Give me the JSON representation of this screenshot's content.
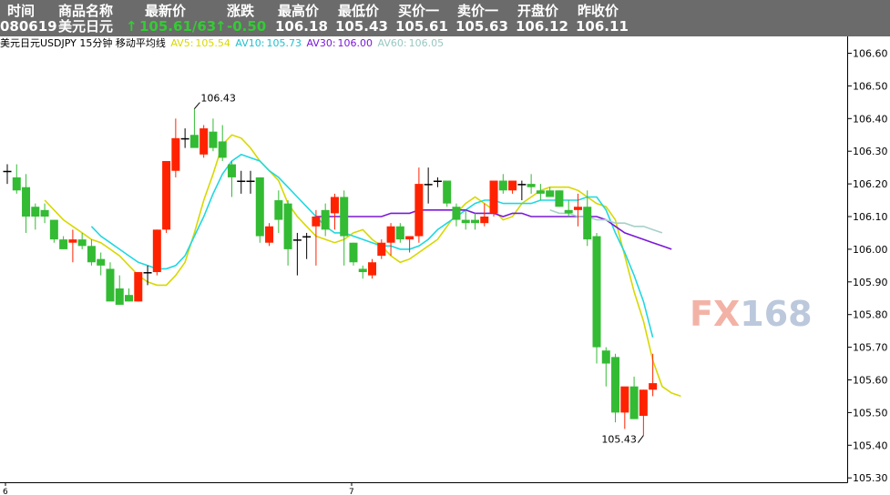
{
  "header": {
    "columns": [
      "时间",
      "商品名称",
      "最新价",
      "涨跌",
      "最高价",
      "最低价",
      "买价一",
      "卖价一",
      "开盘价",
      "昨收价"
    ],
    "values": {
      "time": "080619",
      "name": "美元日元",
      "last": "105.61/63",
      "change": "-0.50",
      "high": "106.18",
      "low": "105.43",
      "bid": "105.61",
      "ask": "105.63",
      "open": "106.12",
      "prev_close": "106.11"
    },
    "arrow": "↑"
  },
  "indicator": {
    "title": "美元日元USDJPY 15分钟 移动平均线",
    "ma": [
      {
        "label": "AV5:",
        "value": "105.54",
        "color": "#d8d800"
      },
      {
        "label": "AV10:",
        "value": "105.73",
        "color": "#20d8e0"
      },
      {
        "label": "AV30:",
        "value": "106.00",
        "color": "#7a18d8"
      },
      {
        "label": "AV60:",
        "value": "106.05",
        "color": "#a8d0c8"
      }
    ]
  },
  "watermark": {
    "left": "FX",
    "right": "168",
    "left_color": "#f2b3a6",
    "right_color": "#bcc8dc"
  },
  "colors": {
    "up": "#ff2200",
    "down": "#33bb33",
    "doji": "#000000",
    "axis": "#000000"
  },
  "chart_data": {
    "type": "candlestick",
    "ylim": [
      105.3,
      106.68
    ],
    "y_ticks": [
      "106.60",
      "106.50",
      "106.40",
      "106.30",
      "106.20",
      "106.10",
      "106.00",
      "105.90",
      "105.80",
      "105.70",
      "105.60",
      "105.50",
      "105.40",
      "105.30"
    ],
    "x_ticks": [
      {
        "label": "6",
        "index": 0
      },
      {
        "label": "7",
        "index": 37
      }
    ],
    "annotations": [
      {
        "text": "106.43",
        "index": 20,
        "value": 106.43
      },
      {
        "text": "105.43",
        "index": 68,
        "value": 105.43
      }
    ],
    "candles": [
      {
        "o": 106.24,
        "h": 106.26,
        "l": 106.2,
        "c": 106.24
      },
      {
        "o": 106.22,
        "h": 106.26,
        "l": 106.17,
        "c": 106.18
      },
      {
        "o": 106.19,
        "h": 106.23,
        "l": 106.05,
        "c": 106.1
      },
      {
        "o": 106.13,
        "h": 106.14,
        "l": 106.06,
        "c": 106.1
      },
      {
        "o": 106.12,
        "h": 106.14,
        "l": 106.08,
        "c": 106.1
      },
      {
        "o": 106.09,
        "h": 106.09,
        "l": 106.02,
        "c": 106.03
      },
      {
        "o": 106.03,
        "h": 106.04,
        "l": 106.0,
        "c": 106.0
      },
      {
        "o": 106.02,
        "h": 106.06,
        "l": 105.96,
        "c": 106.03
      },
      {
        "o": 106.03,
        "h": 106.05,
        "l": 106.0,
        "c": 106.01
      },
      {
        "o": 106.01,
        "h": 106.03,
        "l": 105.95,
        "c": 105.96
      },
      {
        "o": 105.97,
        "h": 105.99,
        "l": 105.92,
        "c": 105.95
      },
      {
        "o": 105.94,
        "h": 105.96,
        "l": 105.85,
        "c": 105.84
      },
      {
        "o": 105.88,
        "h": 105.92,
        "l": 105.83,
        "c": 105.83
      },
      {
        "o": 105.86,
        "h": 105.88,
        "l": 105.84,
        "c": 105.84
      },
      {
        "o": 105.84,
        "h": 105.93,
        "l": 105.84,
        "c": 105.93
      },
      {
        "o": 105.93,
        "h": 105.95,
        "l": 105.89,
        "c": 105.93
      },
      {
        "o": 105.93,
        "h": 106.06,
        "l": 105.92,
        "c": 106.06
      },
      {
        "o": 106.06,
        "h": 106.27,
        "l": 106.05,
        "c": 106.27
      },
      {
        "o": 106.24,
        "h": 106.4,
        "l": 106.22,
        "c": 106.34
      },
      {
        "o": 106.34,
        "h": 106.37,
        "l": 106.31,
        "c": 106.34
      },
      {
        "o": 106.35,
        "h": 106.43,
        "l": 106.33,
        "c": 106.31
      },
      {
        "o": 106.29,
        "h": 106.38,
        "l": 106.28,
        "c": 106.37
      },
      {
        "o": 106.36,
        "h": 106.4,
        "l": 106.3,
        "c": 106.31
      },
      {
        "o": 106.33,
        "h": 106.38,
        "l": 106.27,
        "c": 106.28
      },
      {
        "o": 106.26,
        "h": 106.27,
        "l": 106.16,
        "c": 106.22
      },
      {
        "o": 106.21,
        "h": 106.24,
        "l": 106.17,
        "c": 106.21
      },
      {
        "o": 106.21,
        "h": 106.24,
        "l": 106.17,
        "c": 106.21
      },
      {
        "o": 106.22,
        "h": 106.22,
        "l": 106.02,
        "c": 106.04
      },
      {
        "o": 106.02,
        "h": 106.08,
        "l": 106.01,
        "c": 106.07
      },
      {
        "o": 106.15,
        "h": 106.18,
        "l": 106.05,
        "c": 106.09
      },
      {
        "o": 106.14,
        "h": 106.15,
        "l": 105.95,
        "c": 106.0
      },
      {
        "o": 106.03,
        "h": 106.05,
        "l": 105.92,
        "c": 106.03
      },
      {
        "o": 106.04,
        "h": 106.05,
        "l": 105.97,
        "c": 106.04
      },
      {
        "o": 106.07,
        "h": 106.12,
        "l": 105.95,
        "c": 106.1
      },
      {
        "o": 106.12,
        "h": 106.14,
        "l": 106.04,
        "c": 106.06
      },
      {
        "o": 106.11,
        "h": 106.17,
        "l": 106.06,
        "c": 106.16
      },
      {
        "o": 106.16,
        "h": 106.18,
        "l": 105.95,
        "c": 106.04
      },
      {
        "o": 106.02,
        "h": 106.02,
        "l": 105.95,
        "c": 105.96
      },
      {
        "o": 105.94,
        "h": 105.95,
        "l": 105.91,
        "c": 105.93
      },
      {
        "o": 105.92,
        "h": 105.97,
        "l": 105.91,
        "c": 105.96
      },
      {
        "o": 105.98,
        "h": 106.03,
        "l": 105.97,
        "c": 106.02
      },
      {
        "o": 106.02,
        "h": 106.08,
        "l": 105.98,
        "c": 106.07
      },
      {
        "o": 106.07,
        "h": 106.08,
        "l": 106.02,
        "c": 106.03
      },
      {
        "o": 106.03,
        "h": 106.04,
        "l": 105.99,
        "c": 106.04
      },
      {
        "o": 106.04,
        "h": 106.25,
        "l": 106.02,
        "c": 106.2
      },
      {
        "o": 106.2,
        "h": 106.25,
        "l": 106.14,
        "c": 106.2
      },
      {
        "o": 106.21,
        "h": 106.22,
        "l": 106.19,
        "c": 106.21
      },
      {
        "o": 106.21,
        "h": 106.21,
        "l": 106.13,
        "c": 106.14
      },
      {
        "o": 106.13,
        "h": 106.14,
        "l": 106.07,
        "c": 106.09
      },
      {
        "o": 106.09,
        "h": 106.12,
        "l": 106.06,
        "c": 106.08
      },
      {
        "o": 106.09,
        "h": 106.11,
        "l": 106.06,
        "c": 106.08
      },
      {
        "o": 106.08,
        "h": 106.14,
        "l": 106.07,
        "c": 106.1
      },
      {
        "o": 106.11,
        "h": 106.21,
        "l": 106.1,
        "c": 106.21
      },
      {
        "o": 106.21,
        "h": 106.23,
        "l": 106.17,
        "c": 106.18
      },
      {
        "o": 106.18,
        "h": 106.21,
        "l": 106.17,
        "c": 106.21
      },
      {
        "o": 106.2,
        "h": 106.21,
        "l": 106.15,
        "c": 106.2
      },
      {
        "o": 106.2,
        "h": 106.23,
        "l": 106.17,
        "c": 106.19
      },
      {
        "o": 106.18,
        "h": 106.2,
        "l": 106.15,
        "c": 106.17
      },
      {
        "o": 106.18,
        "h": 106.19,
        "l": 106.16,
        "c": 106.16
      },
      {
        "o": 106.18,
        "h": 106.18,
        "l": 106.13,
        "c": 106.13
      },
      {
        "o": 106.12,
        "h": 106.15,
        "l": 106.1,
        "c": 106.11
      },
      {
        "o": 106.12,
        "h": 106.17,
        "l": 106.07,
        "c": 106.13
      },
      {
        "o": 106.13,
        "h": 106.18,
        "l": 106.01,
        "c": 106.03
      },
      {
        "o": 106.04,
        "h": 106.05,
        "l": 105.65,
        "c": 105.7
      },
      {
        "o": 105.69,
        "h": 105.7,
        "l": 105.58,
        "c": 105.65
      },
      {
        "o": 105.67,
        "h": 105.68,
        "l": 105.47,
        "c": 105.5
      },
      {
        "o": 105.5,
        "h": 105.56,
        "l": 105.45,
        "c": 105.58
      },
      {
        "o": 105.58,
        "h": 105.61,
        "l": 105.48,
        "c": 105.48
      },
      {
        "o": 105.49,
        "h": 105.57,
        "l": 105.43,
        "c": 105.57
      },
      {
        "o": 105.57,
        "h": 105.68,
        "l": 105.55,
        "c": 105.59
      }
    ],
    "series": [
      {
        "name": "AV5",
        "start": 4,
        "values": [
          106.15,
          106.12,
          106.09,
          106.07,
          106.05,
          106.03,
          106.02,
          106.0,
          105.98,
          105.95,
          105.92,
          105.9,
          105.89,
          105.89,
          105.92,
          105.96,
          106.05,
          106.15,
          106.23,
          106.32,
          106.35,
          106.34,
          106.31,
          106.27,
          106.24,
          106.21,
          106.14,
          106.1,
          106.07,
          106.04,
          106.03,
          106.02,
          106.03,
          106.05,
          106.06,
          106.03,
          106.01,
          105.98,
          105.96,
          105.97,
          105.99,
          106.01,
          106.03,
          106.07,
          106.11,
          106.14,
          106.16,
          106.14,
          106.12,
          106.09,
          106.1,
          106.14,
          106.16,
          106.18,
          106.19,
          106.19,
          106.19,
          106.18,
          106.16,
          106.14,
          106.13,
          106.09,
          105.98,
          105.87,
          105.78,
          105.66,
          105.58,
          105.56,
          105.55
        ]
      },
      {
        "name": "AV10",
        "start": 9,
        "values": [
          106.07,
          106.04,
          106.02,
          106.0,
          105.98,
          105.96,
          105.95,
          105.94,
          105.94,
          105.95,
          105.98,
          106.04,
          106.1,
          106.17,
          106.23,
          106.27,
          106.29,
          106.28,
          106.27,
          106.24,
          106.22,
          106.19,
          106.16,
          106.13,
          106.1,
          106.07,
          106.05,
          106.05,
          106.04,
          106.03,
          106.02,
          106.01,
          106.01,
          106.0,
          106.0,
          106.01,
          106.03,
          106.06,
          106.08,
          106.1,
          106.12,
          106.14,
          106.15,
          106.15,
          106.14,
          106.14,
          106.14,
          106.14,
          106.15,
          106.15,
          106.15,
          106.15,
          106.15,
          106.16,
          106.16,
          106.12,
          106.05,
          105.99,
          105.92,
          105.84,
          105.73
        ]
      },
      {
        "name": "AV30",
        "start": 33,
        "values": [
          106.1,
          106.1,
          106.1,
          106.1,
          106.1,
          106.1,
          106.1,
          106.1,
          106.11,
          106.11,
          106.11,
          106.12,
          106.12,
          106.12,
          106.12,
          106.12,
          106.12,
          106.11,
          106.11,
          106.11,
          106.1,
          106.11,
          106.11,
          106.1,
          106.1,
          106.1,
          106.1,
          106.1,
          106.1,
          106.1,
          106.1,
          106.09,
          106.07,
          106.05,
          106.04,
          106.03,
          106.02,
          106.01,
          106.0
        ]
      },
      {
        "name": "AV60",
        "start": 58,
        "values": [
          106.12,
          106.11,
          106.11,
          106.1,
          106.1,
          106.09,
          106.09,
          106.08,
          106.08,
          106.07,
          106.07,
          106.06,
          106.05
        ]
      }
    ]
  }
}
